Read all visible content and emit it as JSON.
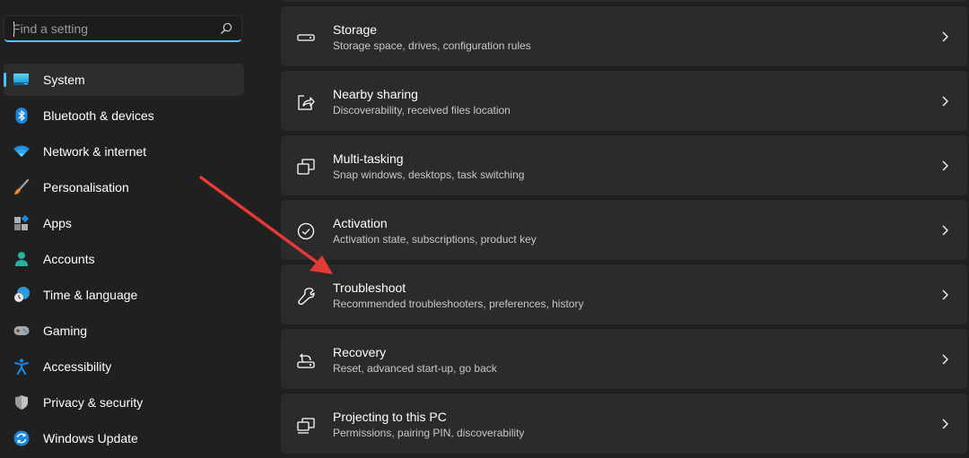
{
  "sidebar": {
    "search": {
      "placeholder": "Find a setting",
      "value": ""
    },
    "items": [
      {
        "label": "System",
        "icon": "system-monitor-icon",
        "active": true
      },
      {
        "label": "Bluetooth & devices",
        "icon": "bluetooth-icon"
      },
      {
        "label": "Network & internet",
        "icon": "wifi-icon"
      },
      {
        "label": "Personalisation",
        "icon": "paintbrush-icon"
      },
      {
        "label": "Apps",
        "icon": "apps-icon"
      },
      {
        "label": "Accounts",
        "icon": "person-icon"
      },
      {
        "label": "Time & language",
        "icon": "clock-globe-icon"
      },
      {
        "label": "Gaming",
        "icon": "gamepad-icon"
      },
      {
        "label": "Accessibility",
        "icon": "accessibility-icon"
      },
      {
        "label": "Privacy & security",
        "icon": "shield-icon"
      },
      {
        "label": "Windows Update",
        "icon": "update-icon"
      }
    ]
  },
  "main": {
    "cards": [
      {
        "title": "Storage",
        "subtitle": "Storage space, drives, configuration rules",
        "icon": "storage-drive-icon"
      },
      {
        "title": "Nearby sharing",
        "subtitle": "Discoverability, received files location",
        "icon": "share-icon"
      },
      {
        "title": "Multi-tasking",
        "subtitle": "Snap windows, desktops, task switching",
        "icon": "multitasking-icon"
      },
      {
        "title": "Activation",
        "subtitle": "Activation state, subscriptions, product key",
        "icon": "check-circle-icon"
      },
      {
        "title": "Troubleshoot",
        "subtitle": "Recommended troubleshooters, preferences, history",
        "icon": "wrench-icon"
      },
      {
        "title": "Recovery",
        "subtitle": "Reset, advanced start-up, go back",
        "icon": "recovery-icon"
      },
      {
        "title": "Projecting to this PC",
        "subtitle": "Permissions, pairing PIN, discoverability",
        "icon": "projecting-icon"
      }
    ]
  },
  "annotation": {
    "type": "arrow",
    "color": "#e53935",
    "points_to": "Troubleshoot"
  },
  "colors": {
    "accent": "#4cc2ff",
    "background": "#202020",
    "card": "#2b2b2b"
  }
}
